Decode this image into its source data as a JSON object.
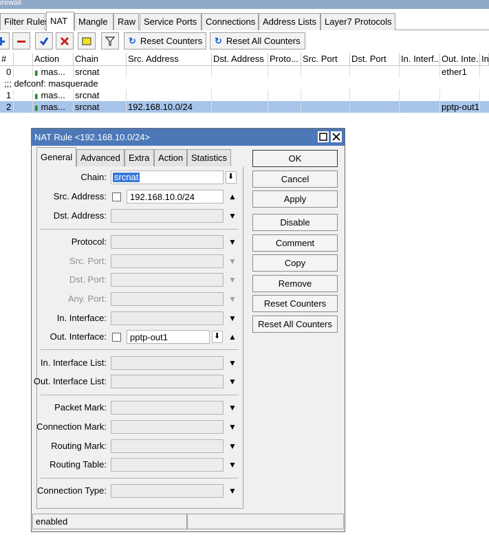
{
  "window_title": "irewall",
  "tabs": [
    {
      "label": "Filter Rules"
    },
    {
      "label": "NAT"
    },
    {
      "label": "Mangle"
    },
    {
      "label": "Raw"
    },
    {
      "label": "Service Ports"
    },
    {
      "label": "Connections"
    },
    {
      "label": "Address Lists"
    },
    {
      "label": "Layer7 Protocols"
    }
  ],
  "toolbar": {
    "reset_counters": "Reset Counters",
    "reset_all_counters": "Reset All Counters"
  },
  "table": {
    "headers": [
      "#",
      "",
      "Action",
      "Chain",
      "Src. Address",
      "Dst. Address",
      "Proto...",
      "Src. Port",
      "Dst. Port",
      "In. Interf...",
      "Out. Inte...",
      "In"
    ],
    "rows": [
      {
        "num": "0",
        "action": "mas...",
        "chain": "srcnat",
        "src": "",
        "out": "ether1"
      },
      {
        "comment": ";;; defconf: masquerade"
      },
      {
        "num": "1",
        "action": "mas...",
        "chain": "srcnat",
        "src": "",
        "out": ""
      },
      {
        "num": "2",
        "action": "mas...",
        "chain": "srcnat",
        "src": "192.168.10.0/24",
        "out": "pptp-out1"
      }
    ]
  },
  "dialog": {
    "title": "NAT Rule <192.168.10.0/24>",
    "tabs": [
      "General",
      "Advanced",
      "Extra",
      "Action",
      "Statistics"
    ],
    "fields": {
      "chain": {
        "label": "Chain:",
        "value": "srcnat"
      },
      "src_address": {
        "label": "Src. Address:",
        "value": "192.168.10.0/24"
      },
      "dst_address": {
        "label": "Dst. Address:"
      },
      "protocol": {
        "label": "Protocol:"
      },
      "src_port": {
        "label": "Src. Port:"
      },
      "dst_port": {
        "label": "Dst. Port:"
      },
      "any_port": {
        "label": "Any. Port:"
      },
      "in_interface": {
        "label": "In. Interface:"
      },
      "out_interface": {
        "label": "Out. Interface:",
        "value": "pptp-out1"
      },
      "in_interface_list": {
        "label": "In. Interface List:"
      },
      "out_interface_list": {
        "label": "Out. Interface List:"
      },
      "packet_mark": {
        "label": "Packet Mark:"
      },
      "connection_mark": {
        "label": "Connection Mark:"
      },
      "routing_mark": {
        "label": "Routing Mark:"
      },
      "routing_table": {
        "label": "Routing Table:"
      },
      "connection_type": {
        "label": "Connection Type:"
      }
    },
    "buttons": [
      "OK",
      "Cancel",
      "Apply",
      "Disable",
      "Comment",
      "Copy",
      "Remove",
      "Reset Counters",
      "Reset All Counters"
    ],
    "status": "enabled"
  },
  "colors": {
    "selection": "#a8c4e8",
    "dialog_title": "#4d78b8",
    "titlebar": "#8fa9c8"
  }
}
